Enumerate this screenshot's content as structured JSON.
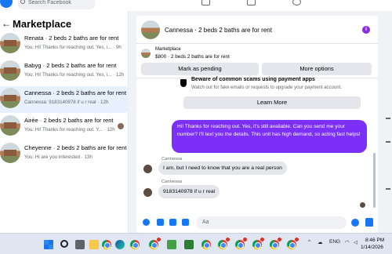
{
  "topbar": {
    "search_placeholder": "Search Facebook"
  },
  "sidebar": {
    "title": "Marketplace",
    "conversations": [
      {
        "title": "Renata · 2 beds 2 baths are for rent",
        "preview": "You: Hi! Thanks for reaching out. Yes, i... · 9h",
        "active": false,
        "unread": false
      },
      {
        "title": "Babyg · 2 beds 2 baths are for rent",
        "preview": "You: Hi! Thanks for reaching out. Yes, i... · 12h",
        "active": false,
        "unread": false
      },
      {
        "title": "Cannessa · 2 beds 2 baths are for rent",
        "preview": "Cannessa: 9183140978 if u r real · 12h",
        "active": true,
        "unread": false
      },
      {
        "title": "Airée · 2 beds 2 baths are for rent",
        "preview": "You: Hi! Thanks for reaching out. Y... · 12h",
        "active": false,
        "unread": true
      },
      {
        "title": "Cheyenne · 2 beds 2 baths are for rent",
        "preview": "You: Hi are you interested · 13h",
        "active": false,
        "unread": false
      }
    ]
  },
  "chat": {
    "header_title": "Cannessa · 2 beds 2 baths are for rent",
    "marketplace_label": "Marketplace",
    "listing_price": "$800 · 2 beds 2 baths are for rent",
    "mark_pending_label": "Mark as pending",
    "more_options_label": "More options",
    "scam_title": "Beware of common scams using payment apps",
    "scam_text": "Watch out for fake emails or requests to upgrade your payment account.",
    "learn_more_label": "Learn More",
    "messages": [
      {
        "from": "me",
        "text": "Hi! Thanks for reaching out. Yes, it's still available. Can you send me your number? I'll text you the details. This unit has high demand, so acting fast helps!"
      },
      {
        "from": "Cannessa",
        "sender": "Cannessa",
        "text": "I am, but I need to know that you are a real person"
      },
      {
        "from": "Cannessa",
        "sender": "Cannessa",
        "text": "9183140978 if u r real"
      }
    ],
    "composer_placeholder": "Aa"
  },
  "taskbar": {
    "language": "ENG",
    "time": "8:46 PM",
    "date": "1/14/2026"
  },
  "colors": {
    "accent": "#1877f2",
    "outgoing_bubble": "#7b2ff7",
    "active_row": "#e7f0fd"
  }
}
